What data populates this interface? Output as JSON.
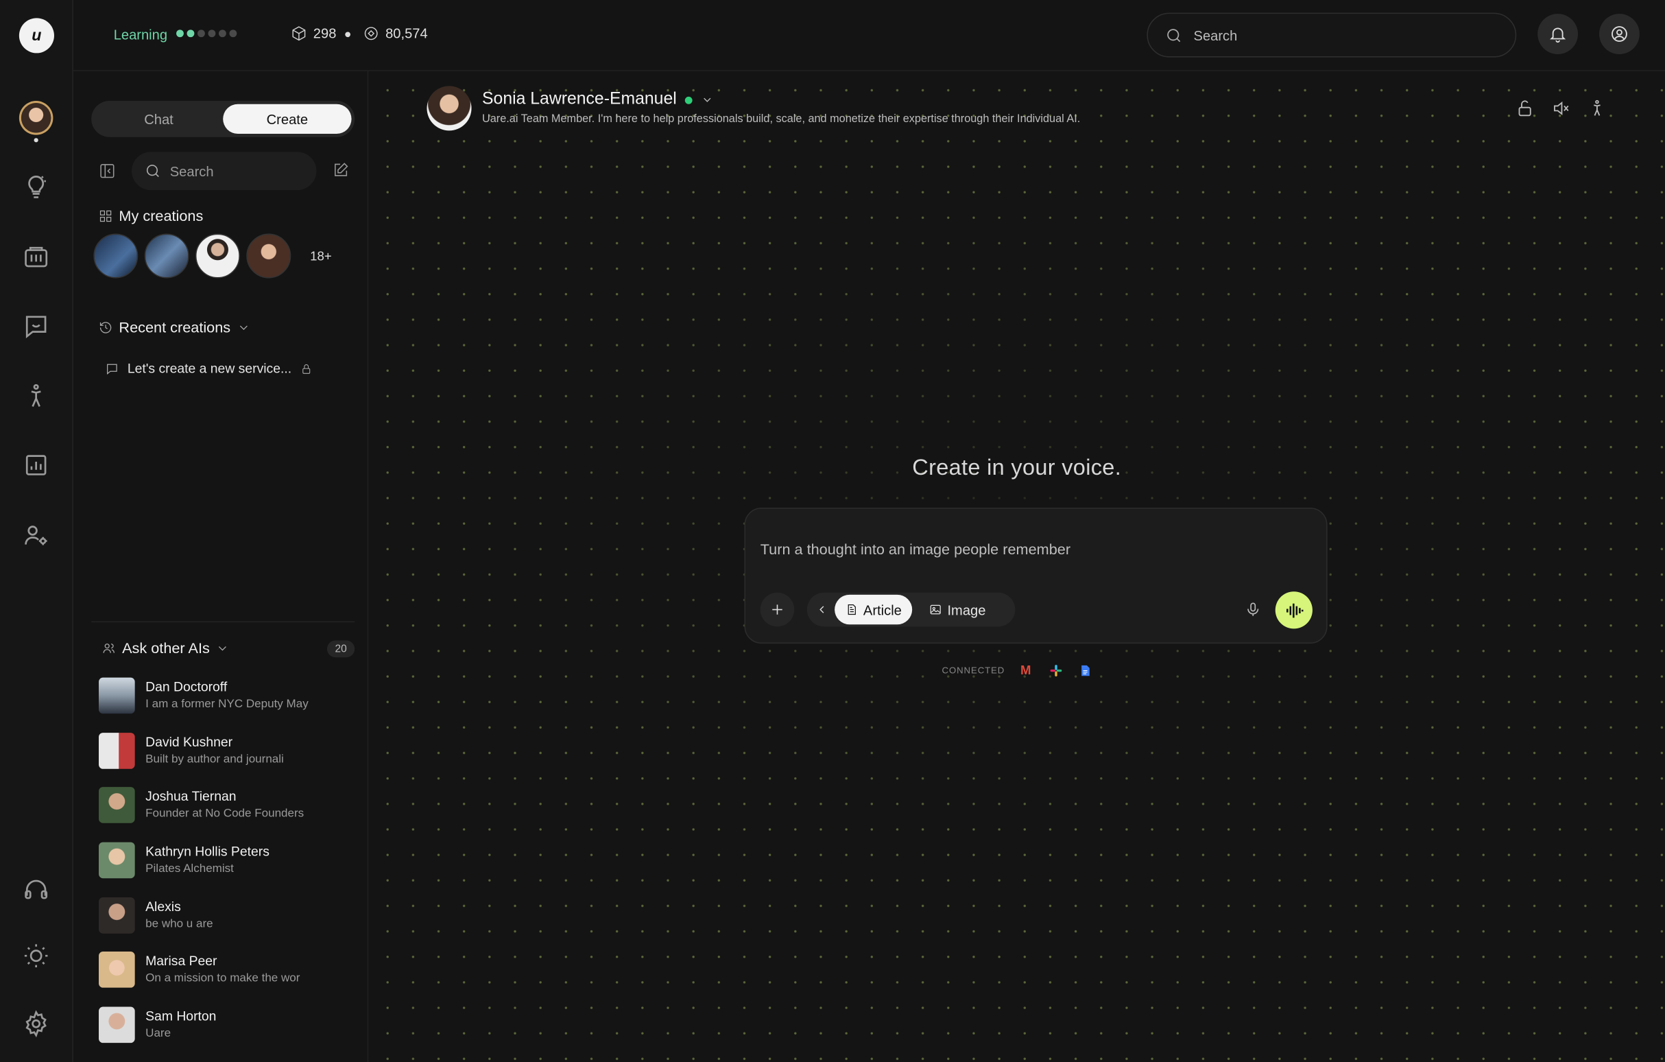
{
  "brand": {
    "logo": "u",
    "accent": "#d6f57a",
    "green": "#6fd6a8"
  },
  "topbar": {
    "learning_label": "Learning",
    "progress": {
      "filled": 2,
      "total": 6
    },
    "stat_one": "298",
    "stat_two": "80,574",
    "search_placeholder": "Search"
  },
  "sidebar": {
    "tabs": [
      {
        "label": "Chat",
        "active": false
      },
      {
        "label": "Create",
        "active": true
      }
    ],
    "search_placeholder": "Search",
    "my_creations_title": "My creations",
    "creations_more": "18+",
    "recent_title": "Recent creations",
    "recent_items": [
      {
        "label": "Let's create a new service...",
        "locked": true
      }
    ],
    "ask_title": "Ask other AIs",
    "ask_count": "20",
    "ais": [
      {
        "name": "Dan Doctoroff",
        "sub": "I am a former NYC Deputy May"
      },
      {
        "name": "David Kushner",
        "sub": "Built by author and journali"
      },
      {
        "name": "Joshua Tiernan",
        "sub": "Founder at No Code Founders"
      },
      {
        "name": "Kathryn Hollis Peters",
        "sub": "Pilates Alchemist"
      },
      {
        "name": "Alexis",
        "sub": "be who u are"
      },
      {
        "name": "Marisa Peer",
        "sub": "On a mission to make the wor"
      },
      {
        "name": "Sam Horton",
        "sub": "Uare"
      }
    ]
  },
  "main": {
    "profile_name": "Sonia Lawrence-Emanuel",
    "profile_desc": "Uare.ai Team Member. I'm here to help professionals build, scale, and monetize their expertise through their Individual AI.",
    "headline": "Create in your voice.",
    "composer_placeholder": "Turn a thought into an image people remember",
    "chips": [
      {
        "label": "Article",
        "active": true
      },
      {
        "label": "Image",
        "active": false
      }
    ],
    "connected_label": "CONNECTED",
    "connected_icons": [
      "gmail-icon",
      "slack-icon",
      "docs-icon"
    ]
  }
}
